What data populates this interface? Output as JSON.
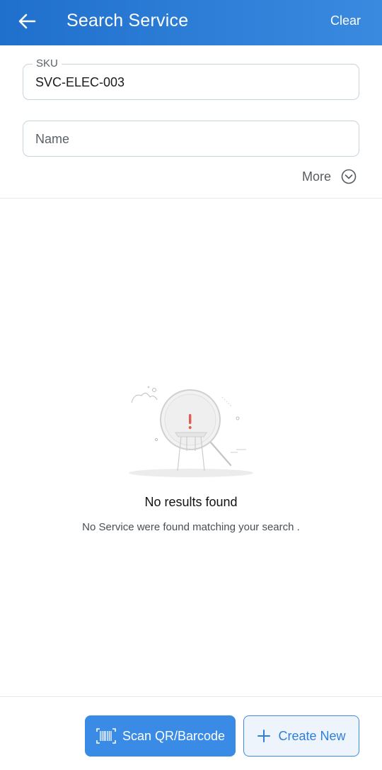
{
  "header": {
    "title": "Search Service",
    "clear_label": "Clear",
    "back_icon": "arrow-left-icon"
  },
  "form": {
    "sku": {
      "label": "SKU",
      "value": "SVC-ELEC-003"
    },
    "name": {
      "placeholder": "Name",
      "value": ""
    },
    "more_label": "More",
    "more_icon": "chevron-down-circle-icon"
  },
  "empty_state": {
    "title": "No results found",
    "subtitle": "No Service were found matching your search ."
  },
  "actions": {
    "scan_label": "Scan QR/Barcode",
    "scan_icon": "barcode-icon",
    "create_label": "Create New",
    "create_icon": "plus-icon"
  },
  "colors": {
    "primary": "#2f7fd9",
    "header_gradient_start": "#1f70cc",
    "header_gradient_end": "#3a8ae0",
    "alert": "#e25b4f"
  }
}
